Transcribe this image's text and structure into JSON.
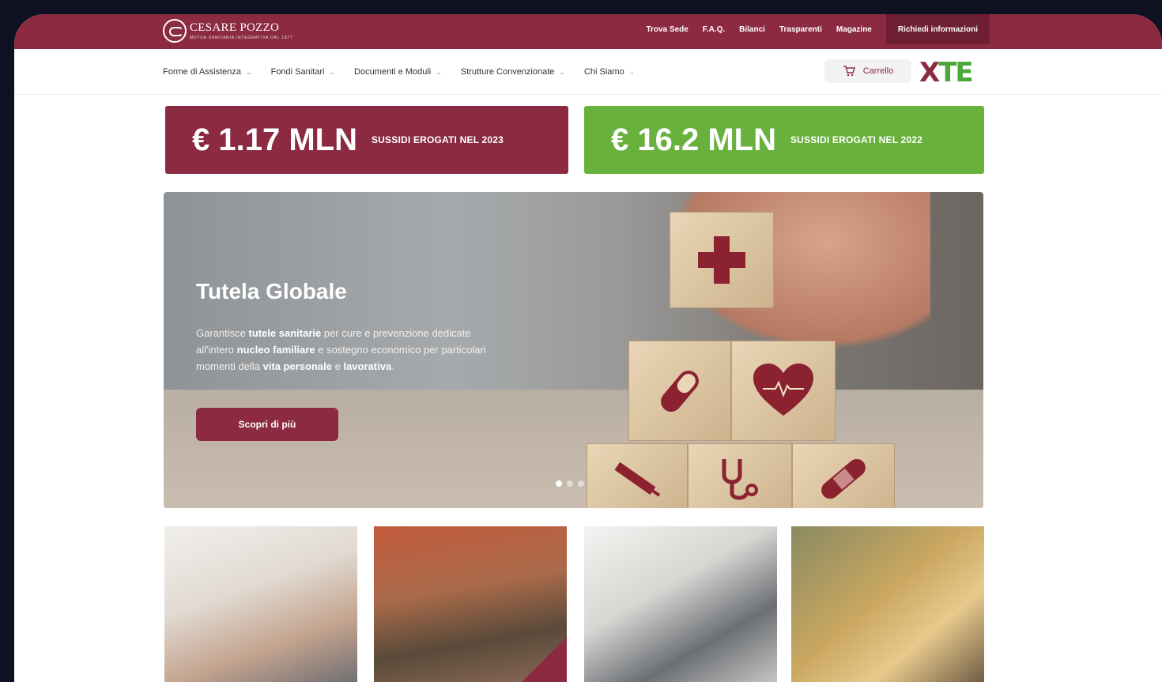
{
  "brand": {
    "name": "CESARE POZZO",
    "tagline": "MUTUA SANITARIA INTEGRATIVA DAL 1877"
  },
  "top_links": [
    "Trova Sede",
    "F.A.Q.",
    "Bilanci",
    "Trasparenti",
    "Magazine"
  ],
  "request_button": "Richiedi informazioni",
  "nav": [
    "Forme di Assistenza",
    "Fondi Sanitari",
    "Documenti e Moduli",
    "Strutture Convenzionate",
    "Chi Siamo"
  ],
  "cart_label": "Carrello",
  "partner_logo": "XTE",
  "stats": [
    {
      "value": "€ 1.17 MLN",
      "label": "SUSSIDI EROGATI NEL 2023"
    },
    {
      "value": "€ 16.2 MLN",
      "label": "SUSSIDI EROGATI NEL 2022"
    }
  ],
  "hero": {
    "title": "Tutela Globale",
    "text_parts": [
      "Garantisce ",
      "tutele sanitarie",
      " per cure e prevenzione dedicate all'intero ",
      "nucleo familiare",
      " e sostegno economico per particolari momenti della ",
      "vita personale",
      " e ",
      "lavorativa",
      "."
    ],
    "cta": "Scopri di più",
    "slides_active": 1,
    "slides_total": 3
  },
  "colors": {
    "brand_red": "#8b2a41",
    "brand_green": "#68b13c",
    "page_bg": "#0e1122"
  },
  "icons": [
    "cart-icon",
    "cross-icon",
    "capsule-icon",
    "heart-icon",
    "stethoscope-icon",
    "syringe-icon",
    "bandage-icon"
  ]
}
